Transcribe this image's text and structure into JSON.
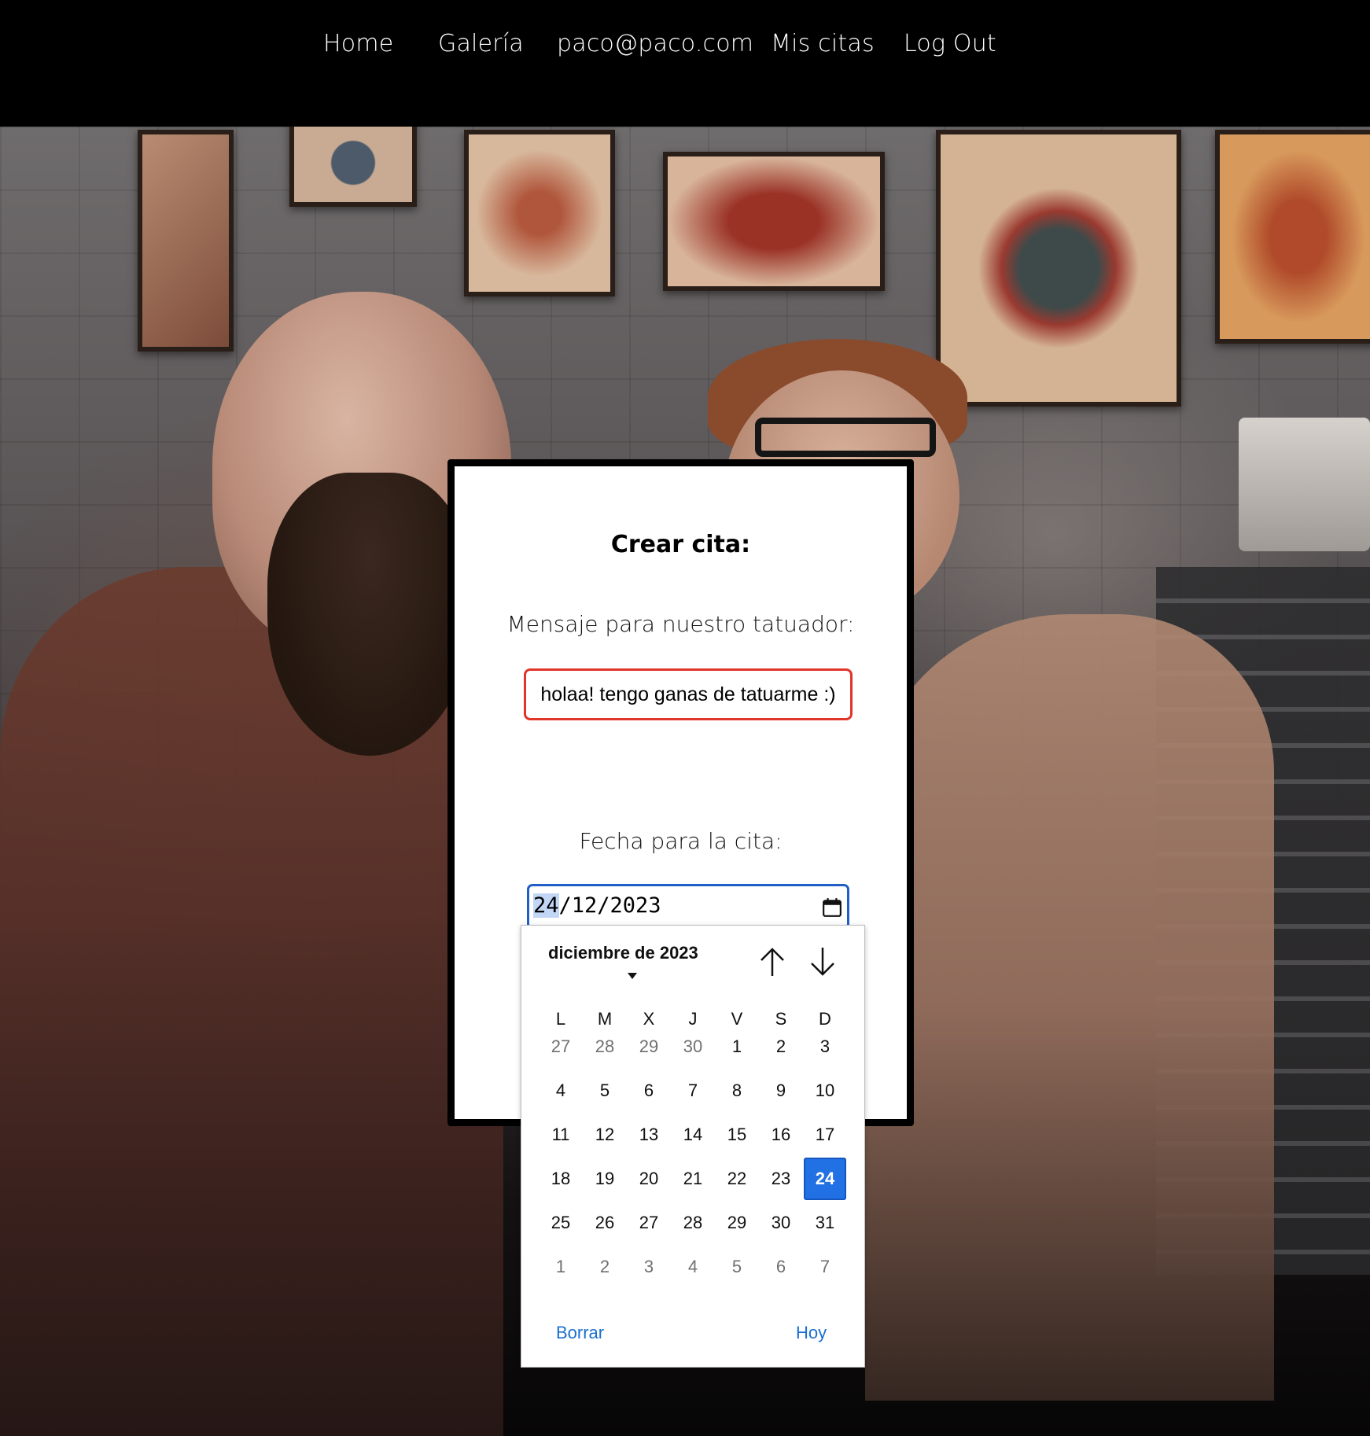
{
  "nav": {
    "items": [
      {
        "label": "Home"
      },
      {
        "label": "Galería"
      },
      {
        "label": "paco@paco.com"
      },
      {
        "label": "Mis citas"
      },
      {
        "label": "Log Out"
      }
    ]
  },
  "form": {
    "title": "Crear cita:",
    "message_label": "Mensaje para nuestro tatuador:",
    "message_value": "holaa! tengo ganas de tatuarme :)",
    "date_label": "Fecha para la cita:",
    "date_day": "24",
    "date_rest": "/12/2023"
  },
  "datepicker": {
    "month_label": "diciembre de 2023",
    "weekdays": [
      "L",
      "M",
      "X",
      "J",
      "V",
      "S",
      "D"
    ],
    "weeks": [
      [
        "27",
        "28",
        "29",
        "30",
        "1",
        "2",
        "3"
      ],
      [
        "4",
        "5",
        "6",
        "7",
        "8",
        "9",
        "10"
      ],
      [
        "11",
        "12",
        "13",
        "14",
        "15",
        "16",
        "17"
      ],
      [
        "18",
        "19",
        "20",
        "21",
        "22",
        "23",
        "24"
      ],
      [
        "25",
        "26",
        "27",
        "28",
        "29",
        "30",
        "31"
      ],
      [
        "1",
        "2",
        "3",
        "4",
        "5",
        "6",
        "7"
      ]
    ],
    "selected_day": "24",
    "clear_label": "Borrar",
    "today_label": "Hoy"
  },
  "colors": {
    "accent_blue": "#2170e4",
    "error_red": "#e0352b",
    "link_blue": "#1a6fd1"
  }
}
